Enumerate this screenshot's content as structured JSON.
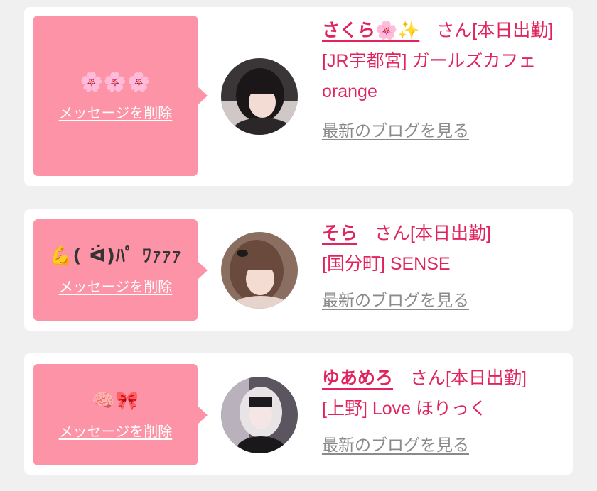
{
  "entries": [
    {
      "message": "🌸🌸🌸",
      "delete_label": "メッセージを削除",
      "name": "さくら🌸✨",
      "honorific": "さん",
      "status": "[本日出勤]",
      "shop": "[JR宇都宮] ガールズカフェorange",
      "blog_link": "最新のブログを見る"
    },
    {
      "message": "💪( ᐛ)ﾊﾟ ﾜｧｧｧ",
      "delete_label": "メッセージを削除",
      "name": "そら",
      "honorific": "さん",
      "status": "[本日出勤]",
      "shop": "[国分町] SENSE",
      "blog_link": "最新のブログを見る"
    },
    {
      "message": "🧠🎀",
      "delete_label": "メッセージを削除",
      "name": "ゆあめろ",
      "honorific": "さん",
      "status": "[本日出勤]",
      "shop": "[上野] Love ほりっく",
      "blog_link": "最新のブログを見る"
    }
  ],
  "colors": {
    "bubble": "#fc93a6",
    "accent": "#e0245e",
    "muted_link": "#8a8a8a",
    "background": "#f0f0f0"
  }
}
